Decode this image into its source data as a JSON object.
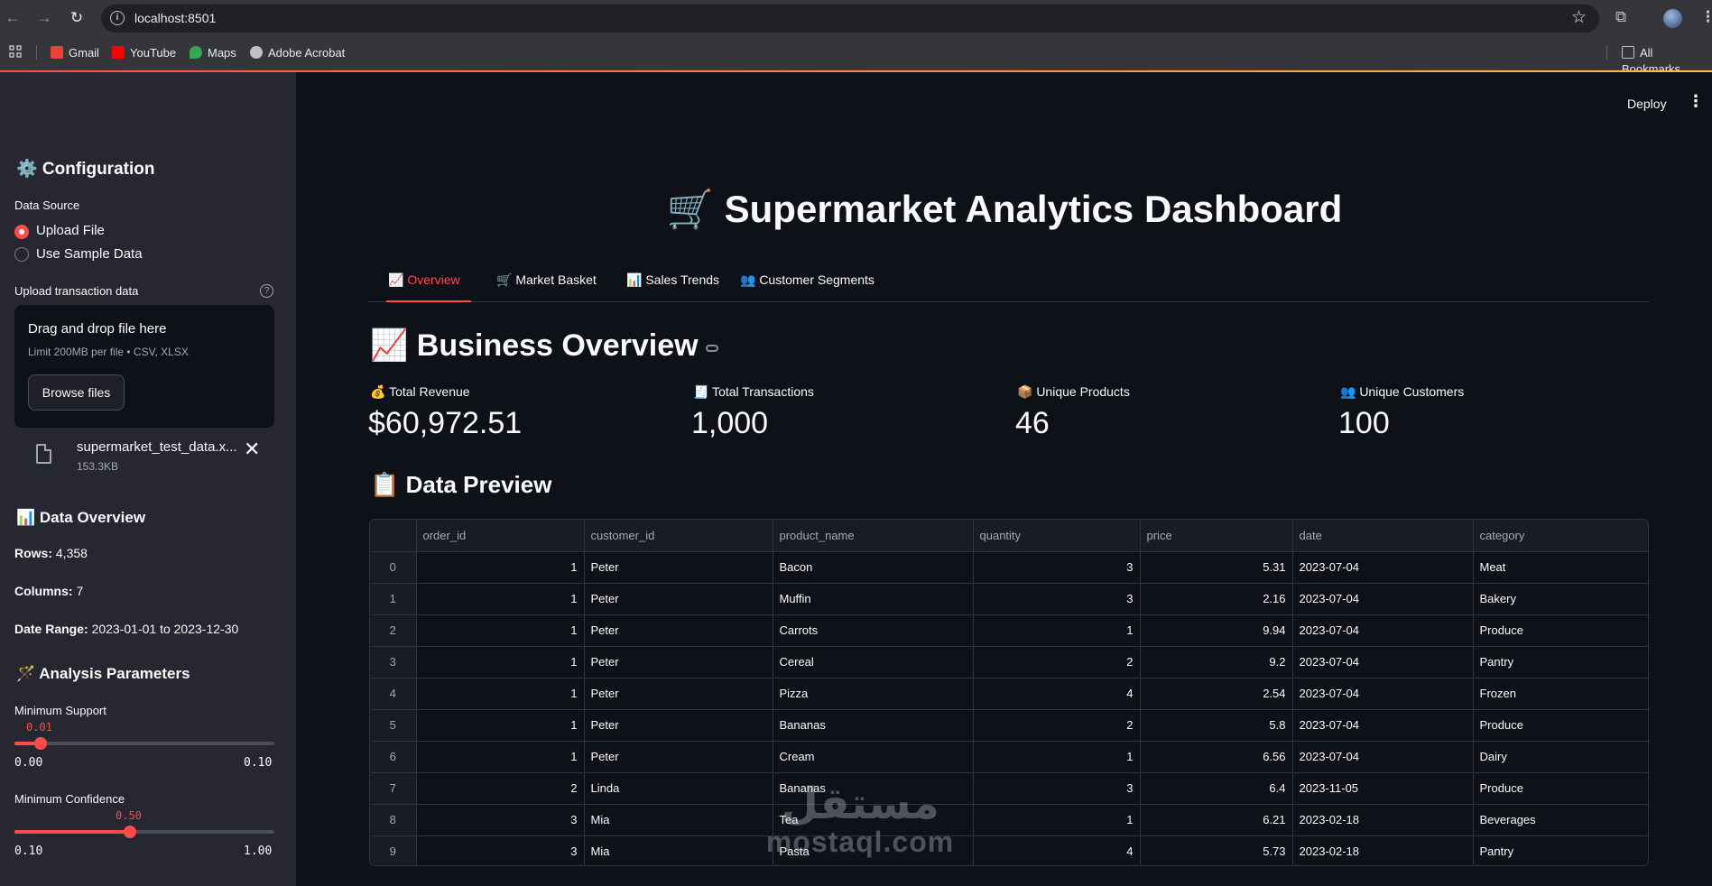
{
  "browser": {
    "url": "localhost:8501",
    "bookmarks": [
      {
        "label": "Gmail",
        "color": "#ea4335"
      },
      {
        "label": "YouTube",
        "color": "#ff0000"
      },
      {
        "label": "Maps",
        "color": "#34a853"
      },
      {
        "label": "Adobe Acrobat",
        "color": "#bdc1c6"
      }
    ],
    "all_bookmarks": "All Bookmarks"
  },
  "sidebar": {
    "config_title": "⚙️ Configuration",
    "data_source_label": "Data Source",
    "radio_options": [
      "Upload File",
      "Use Sample Data"
    ],
    "radio_selected": "Upload File",
    "upload_label": "Upload transaction data",
    "dropzone_title": "Drag and drop file here",
    "dropzone_limit": "Limit 200MB per file • CSV, XLSX",
    "browse_label": "Browse files",
    "file_name": "supermarket_test_data.x...",
    "file_size": "153.3KB",
    "data_overview_title": "📊 Data Overview",
    "rows_label": "Rows:",
    "rows_value": "4,358",
    "columns_label": "Columns:",
    "columns_value": "7",
    "date_range_label": "Date Range:",
    "date_range_value": "2023-01-01 to 2023-12-30",
    "analysis_title": "🪄 Analysis Parameters",
    "min_support": {
      "label": "Minimum Support",
      "value": "0.01",
      "min": "0.00",
      "max": "0.10",
      "fraction": 0.1
    },
    "min_confidence": {
      "label": "Minimum Confidence",
      "value": "0.50",
      "min": "0.10",
      "max": "1.00",
      "fraction": 0.4444
    }
  },
  "header": {
    "deploy": "Deploy",
    "menu": "⋮"
  },
  "main": {
    "title": "🛒 Supermarket Analytics Dashboard",
    "tabs": [
      "📈 Overview",
      "🛒 Market Basket",
      "📊 Sales Trends",
      "👥 Customer Segments"
    ],
    "active_tab": 0,
    "overview_title": "📈 Business Overview",
    "metrics": [
      {
        "label": "💰 Total Revenue",
        "value": "$60,972.51"
      },
      {
        "label": "🧾 Total Transactions",
        "value": "1,000"
      },
      {
        "label": "📦 Unique Products",
        "value": "46"
      },
      {
        "label": "👥 Unique Customers",
        "value": "100"
      }
    ],
    "preview_title": "📋 Data Preview",
    "table": {
      "columns": [
        "",
        "order_id",
        "customer_id",
        "product_name",
        "quantity",
        "price",
        "date",
        "category"
      ],
      "rows": [
        [
          "0",
          "1",
          "Peter",
          "Bacon",
          "3",
          "5.31",
          "2023-07-04",
          "Meat"
        ],
        [
          "1",
          "1",
          "Peter",
          "Muffin",
          "3",
          "2.16",
          "2023-07-04",
          "Bakery"
        ],
        [
          "2",
          "1",
          "Peter",
          "Carrots",
          "1",
          "9.94",
          "2023-07-04",
          "Produce"
        ],
        [
          "3",
          "1",
          "Peter",
          "Cereal",
          "2",
          "9.2",
          "2023-07-04",
          "Pantry"
        ],
        [
          "4",
          "1",
          "Peter",
          "Pizza",
          "4",
          "2.54",
          "2023-07-04",
          "Frozen"
        ],
        [
          "5",
          "1",
          "Peter",
          "Bananas",
          "2",
          "5.8",
          "2023-07-04",
          "Produce"
        ],
        [
          "6",
          "1",
          "Peter",
          "Cream",
          "1",
          "6.56",
          "2023-07-04",
          "Dairy"
        ],
        [
          "7",
          "2",
          "Linda",
          "Bananas",
          "3",
          "6.4",
          "2023-11-05",
          "Produce"
        ],
        [
          "8",
          "3",
          "Mia",
          "Tea",
          "1",
          "6.21",
          "2023-02-18",
          "Beverages"
        ],
        [
          "9",
          "3",
          "Mia",
          "Pasta",
          "4",
          "5.73",
          "2023-02-18",
          "Pantry"
        ]
      ]
    }
  },
  "watermark": {
    "line1": "مستقل",
    "line2": "mostaql.com"
  }
}
